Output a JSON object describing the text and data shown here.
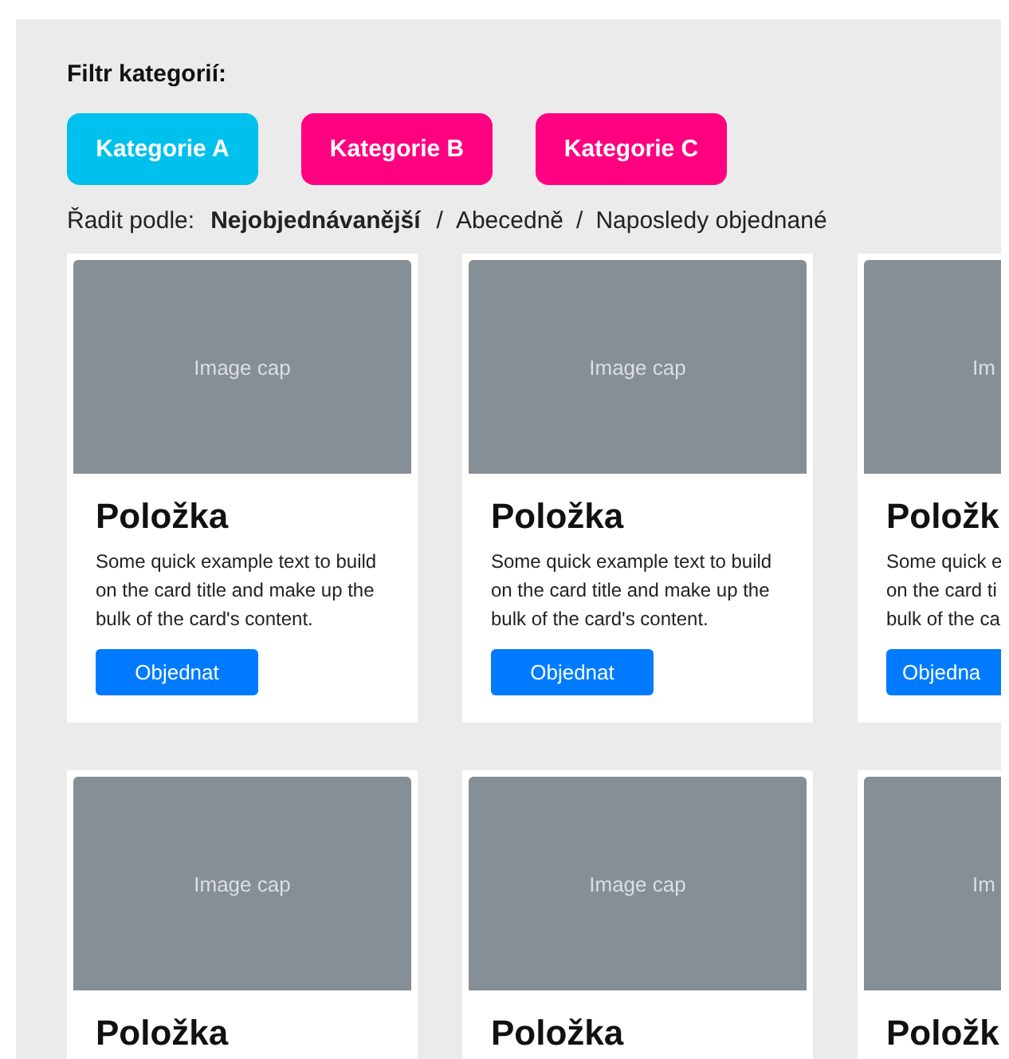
{
  "filter": {
    "label": "Filtr kategorií:",
    "categories": [
      {
        "label": "Kategorie A",
        "selected": true
      },
      {
        "label": "Kategorie B",
        "selected": false
      },
      {
        "label": "Kategorie C",
        "selected": false
      }
    ]
  },
  "sort": {
    "label": "Řadit podle:",
    "options": [
      {
        "label": "Nejobjednávanější",
        "selected": true
      },
      {
        "separator": "/",
        "label": "Abecedně",
        "selected": false
      },
      {
        "separator": "/",
        "label": "Naposledy objednané",
        "selected": false
      }
    ]
  },
  "card_rows": [
    {
      "cards": [
        {
          "kind": "full",
          "image_caption": "Image cap",
          "title": "Položka",
          "text_lines": [
            "Some quick example text to build",
            "on the card title and make up the",
            "bulk of the card's content."
          ],
          "button": "Objednat"
        },
        {
          "kind": "full",
          "image_caption": "Image cap",
          "title": "Položka",
          "text_lines": [
            "Some quick example text to build",
            "on the card title and make up the",
            "bulk of the card's content."
          ],
          "button": "Objednat"
        },
        {
          "kind": "clipped",
          "image_caption": "Im",
          "title": "Položk",
          "text_lines": [
            "Some quick e",
            "on the card ti",
            "bulk of the ca"
          ],
          "button": "Objedna"
        }
      ]
    },
    {
      "cards": [
        {
          "kind": "full",
          "image_caption": "Image cap",
          "title": "Položka"
        },
        {
          "kind": "full",
          "image_caption": "Image cap",
          "title": "Položka"
        },
        {
          "kind": "clipped",
          "image_caption": "Im",
          "title": "Položk"
        }
      ]
    }
  ]
}
